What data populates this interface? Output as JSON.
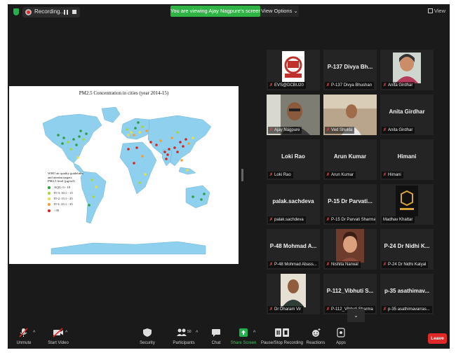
{
  "app": {
    "recording_label": "Recording...",
    "banner_text": "You are viewing Ajay Nagpure's screen",
    "view_options_label": "View Options ⌄",
    "view_label": "View"
  },
  "shared_screen": {
    "title": "PM2.5 Concentration in cities (year 2014-15)",
    "legend_heading_lines": [
      "WHO air quality guidelines",
      "and interim targets",
      "PM2.5 level  (µg/m3)"
    ],
    "legend_items": [
      {
        "label": "AQG: 0 - 10",
        "color": "#2e9e3e"
      },
      {
        "label": "IT-3: 10.1 - 15",
        "color": "#a5d63a"
      },
      {
        "label": "IT-2: 15.1 - 25",
        "color": "#e8e040"
      },
      {
        "label": "IT-1: 25.1 - 35",
        "color": "#f0a030"
      },
      {
        "label": ">35",
        "color": "#d8241f"
      }
    ]
  },
  "participants": [
    {
      "name": "",
      "label": "EVS@DCBU20",
      "video": "logo"
    },
    {
      "name": "P-137 Divya Bh...",
      "label": "P-137 Divya Bhushan"
    },
    {
      "name": "",
      "label": "Anita Girdhar",
      "video": "woman"
    },
    {
      "name": "",
      "label": "Ajay Nagpure",
      "video": "man-glasses",
      "active": true
    },
    {
      "name": "",
      "label": "Ved Shukla",
      "video": "man-room"
    },
    {
      "name": "Anita Girdhar",
      "label": "Anita Girdhar"
    },
    {
      "name": "Loki Rao",
      "label": "Loki Rao"
    },
    {
      "name": "Arun Kumar",
      "label": "Arun Kumar"
    },
    {
      "name": "Himani",
      "label": "Himani"
    },
    {
      "name": "palak.sachdeva",
      "label": "palak.sachdeva"
    },
    {
      "name": "P-15 Dr Parvati...",
      "label": "P-15 Dr Parvati Sharma"
    },
    {
      "name": "",
      "label": "Madhav Khattar",
      "video": "logo-dark",
      "muted": false
    },
    {
      "name": "P-48 Mohmad A...",
      "label": "P-48 Mohmad Abass..."
    },
    {
      "name": "",
      "label": "Nishita Narwal",
      "video": "woman-2"
    },
    {
      "name": "P-24 Dr Nidhi K...",
      "label": "P-24 Dr Nidhi Katyal"
    },
    {
      "name": "",
      "label": "Dr Dharam Vir",
      "video": "man-2"
    },
    {
      "name": "P-112_Vibhuti S...",
      "label": "P-112_Vibhuti Sharma"
    },
    {
      "name": "p-35 asathimav...",
      "label": "p-35 asathimavarras..."
    }
  ],
  "toolbar": {
    "unmute": "Unmute",
    "start_video": "Start Video",
    "security": "Security",
    "participants": "Participants",
    "participants_count": "50",
    "chat": "Chat",
    "share_screen": "Share Screen",
    "pause_recording": "Pause/Stop Recording",
    "reactions": "Reactions",
    "apps": "Apps",
    "leave": "Leave"
  },
  "colors": {
    "share_green": "#22b14c",
    "leave_red": "#e02828",
    "active_speaker": "#b9e266",
    "ocean": "#ffffff",
    "land": "#8ed0ee"
  }
}
